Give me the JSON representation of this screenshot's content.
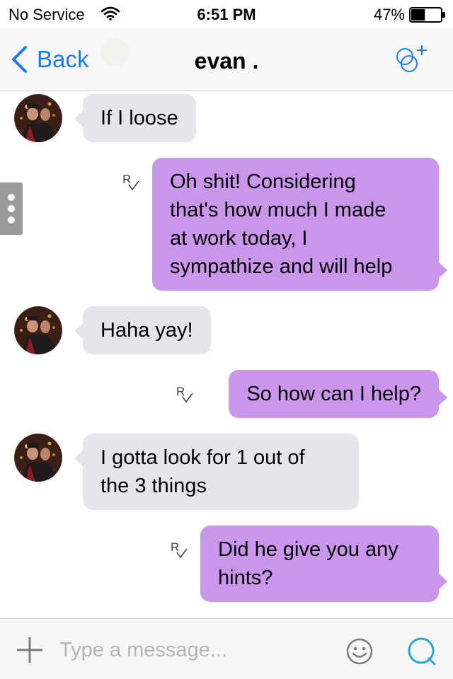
{
  "status_bar": {
    "carrier": "No Service",
    "time": "6:51 PM",
    "battery_percent": "47%",
    "battery_level": 0.47,
    "wifi_icon": "wifi-icon",
    "battery_icon": "battery-icon"
  },
  "nav": {
    "back_label": "Back",
    "title": "evan .",
    "back_icon": "chevron-left-icon",
    "add_icon": "add-participant-icon"
  },
  "side_handle_icon": "vertical-dots-icon",
  "messages": [
    {
      "direction": "incoming",
      "lines": [
        "If I loose"
      ]
    },
    {
      "direction": "outgoing",
      "read_receipt": "R",
      "lines": [
        "Oh shit! Considering",
        "that's how much I made",
        "at work today, I",
        "sympathize and will help"
      ]
    },
    {
      "direction": "incoming",
      "lines": [
        "Haha yay!"
      ]
    },
    {
      "direction": "outgoing",
      "read_receipt": "R",
      "lines": [
        "So how can I help?"
      ]
    },
    {
      "direction": "incoming",
      "lines": [
        "I gotta look for 1 out of",
        "the 3 things"
      ]
    },
    {
      "direction": "outgoing",
      "read_receipt": "R",
      "lines": [
        "Did he give you any",
        "hints?"
      ]
    }
  ],
  "input_bar": {
    "placeholder": "Type a message...",
    "value": "",
    "plus_icon": "plus-icon",
    "emoji_icon": "smiley-icon",
    "send_icon": "chat-bubble-icon"
  },
  "colors": {
    "accent": "#1a7cf2",
    "incoming_bubble": "#e6e6ea",
    "outgoing_bubble": "#c996ec",
    "send_icon": "#2aa5d8"
  }
}
